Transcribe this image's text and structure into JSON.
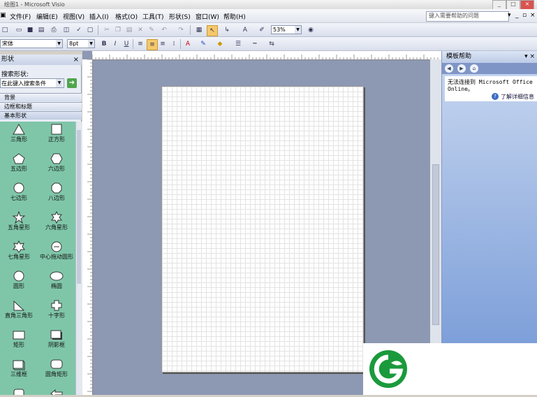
{
  "window": {
    "title": "绘图1 - Microsoft Visio"
  },
  "menu": {
    "items": [
      "文件(F)",
      "编辑(E)",
      "视图(V)",
      "插入(I)",
      "格式(O)",
      "工具(T)",
      "形状(S)",
      "窗口(W)",
      "帮助(H)"
    ],
    "help_placeholder": "键入需要帮助的问题"
  },
  "toolbar": {
    "zoom": "53%",
    "font": "宋体",
    "font_size": "8pt",
    "bold": "B",
    "italic": "I",
    "underline": "U"
  },
  "shapes_panel": {
    "title": "形状",
    "search_label": "搜索形状:",
    "search_placeholder": "在此键入搜索条件",
    "stencils": [
      "背景",
      "边框和标题",
      "基本形状"
    ],
    "shapes": [
      {
        "label": "三角形",
        "icon": "triangle-icon"
      },
      {
        "label": "正方形",
        "icon": "square-icon"
      },
      {
        "label": "五边形",
        "icon": "pentagon-icon"
      },
      {
        "label": "六边形",
        "icon": "hexagon-icon"
      },
      {
        "label": "七边形",
        "icon": "heptagon-icon"
      },
      {
        "label": "八边形",
        "icon": "octagon-icon"
      },
      {
        "label": "五角星形",
        "icon": "five-point-star-icon"
      },
      {
        "label": "六角星形",
        "icon": "six-point-star-icon"
      },
      {
        "label": "七角星形",
        "icon": "seven-point-star-icon"
      },
      {
        "label": "中心拖动圆形",
        "icon": "center-drag-circle-icon"
      },
      {
        "label": "圆形",
        "icon": "circle-icon"
      },
      {
        "label": "椭圆",
        "icon": "ellipse-icon"
      },
      {
        "label": "直角三角形",
        "icon": "right-triangle-icon"
      },
      {
        "label": "十字形",
        "icon": "cross-icon"
      },
      {
        "label": "矩形",
        "icon": "rectangle-icon"
      },
      {
        "label": "阴影框",
        "icon": "shadow-box-icon"
      },
      {
        "label": "三维框",
        "icon": "3d-box-icon"
      },
      {
        "label": "圆角矩形",
        "icon": "rounded-rectangle-icon"
      }
    ]
  },
  "task_pane": {
    "title": "模板帮助",
    "message_line1": "无法连接到 Microsoft Office",
    "message_line2": "Online。",
    "more_info": "了解详细信息"
  },
  "colors": {
    "stencil_bg": "#7fc6a9",
    "canvas_bg": "#8d98b3",
    "logo_green": "#1a9a3c"
  }
}
